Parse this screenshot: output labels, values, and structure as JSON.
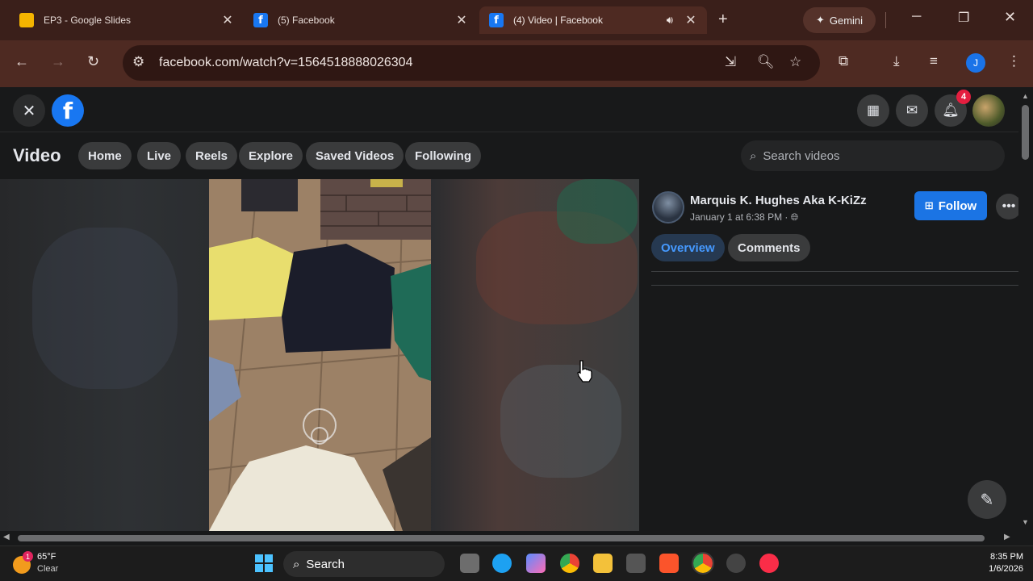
{
  "browser": {
    "tabs": [
      {
        "title": "EP3 - Google Slides",
        "favicon": "google-slides-icon"
      },
      {
        "title": "(5) Facebook",
        "favicon": "facebook-icon"
      },
      {
        "title": "(4) Video | Facebook",
        "favicon": "facebook-icon",
        "active": true,
        "audio": true
      }
    ],
    "gemini_label": "Gemini",
    "url": "facebook.com/watch?v=1564518888026304",
    "profile_initial": "J"
  },
  "facebook": {
    "logo_glyph": "f",
    "notification_count": "4",
    "section_title": "Video",
    "nav": [
      "Home",
      "Live",
      "Reels",
      "Explore",
      "Saved Videos",
      "Following"
    ],
    "search_placeholder": "Search videos",
    "post": {
      "author": "Marquis K. Hughes Aka K-KiZz",
      "date": "January 1 at 6:38 PM · ",
      "follow_label": "Follow",
      "tabs": [
        "Overview",
        "Comments"
      ],
      "active_tab": "Overview"
    }
  },
  "taskbar": {
    "weather_temp": "65°F",
    "weather_desc": "Clear",
    "weather_alert": "1",
    "search_label": "Search",
    "time": "8:35 PM",
    "date": "1/6/2026"
  },
  "colors": {
    "chrome_frame": "#3a1f1a",
    "chrome_toolbar": "#4e2a22",
    "fb_blue": "#1b74e4",
    "fb_bg": "#18191a"
  }
}
